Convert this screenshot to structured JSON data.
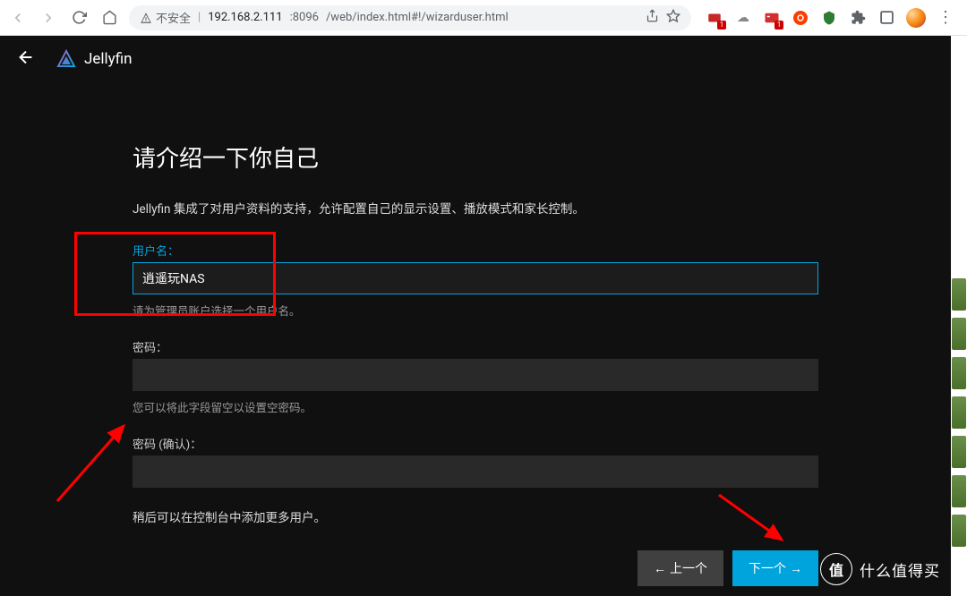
{
  "browser": {
    "security_warn": "不安全",
    "url_host": "192.168.2.111",
    "url_port": ":8096",
    "url_path": "/web/index.html#!/wizarduser.html",
    "ext_badge": "1"
  },
  "header": {
    "brand": "Jellyfin"
  },
  "wizard": {
    "title": "请介绍一下你自己",
    "desc": "Jellyfin 集成了对用户资料的支持，允许配置自己的显示设置、播放模式和家长控制。",
    "username": {
      "label": "用户名：",
      "value": "逍遥玩NAS",
      "help": "请为管理员账户选择一个用户名。"
    },
    "password": {
      "label": "密码：",
      "value": "",
      "help": "您可以将此字段留空以设置空密码。"
    },
    "password_confirm": {
      "label": "密码 (确认)：",
      "value": ""
    },
    "note": "稍后可以在控制台中添加更多用户。",
    "btn_prev": "上一个",
    "btn_next": "下一个",
    "arrow_prev": "←",
    "arrow_next": "→"
  },
  "watermark": {
    "char": "值",
    "text": "什么值得买"
  }
}
